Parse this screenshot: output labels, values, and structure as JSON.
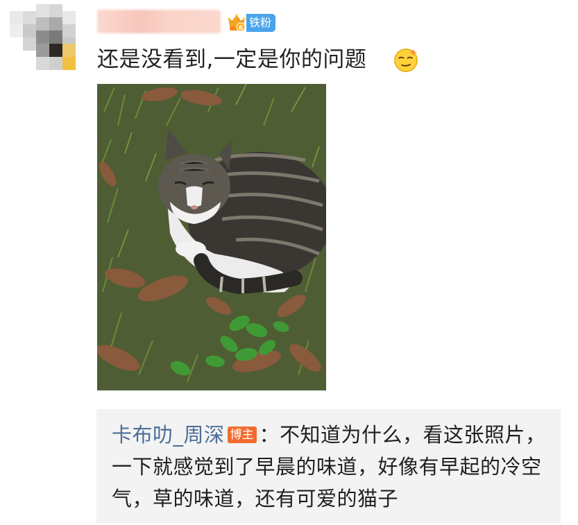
{
  "comment": {
    "fan_badge_label": "铁粉",
    "crown_level": "6",
    "text": "还是没看到,一定是你的问题",
    "emoji": "doge-sleepy-face-icon"
  },
  "reply": {
    "author": "卡布叻_周深",
    "author_badge": "博主",
    "separator": "：",
    "text": "不知道为什么，看这张照片，一下就感觉到了早晨的味道，好像有早起的冷空气，草的味道，还有可爱的猫子"
  },
  "colors": {
    "fan_badge": "#4aa3ec",
    "author_link": "#4a6e98",
    "blogger_badge": "#f36a2e",
    "reply_background": "#f3f3f3"
  }
}
